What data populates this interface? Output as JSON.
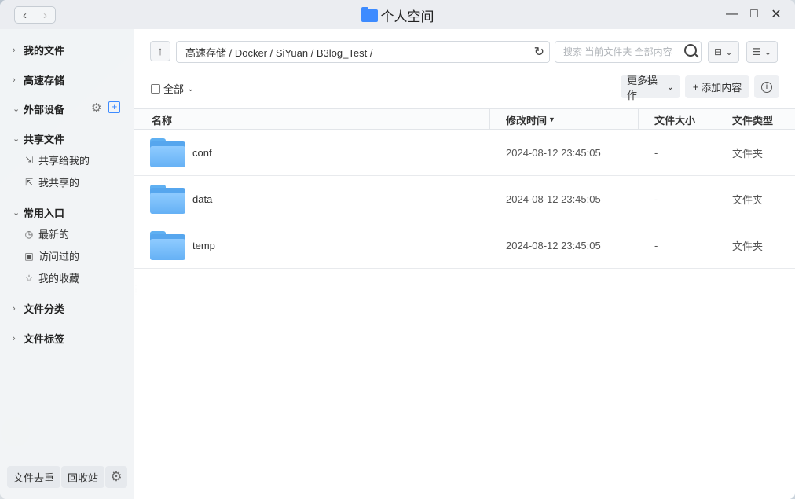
{
  "window": {
    "title": "个人空间",
    "nav_back": "‹",
    "nav_forward": "›",
    "controls": {
      "minimize": "—",
      "maximize": "□",
      "close": "✕"
    }
  },
  "sidebar": {
    "groups": [
      {
        "label": "我的文件",
        "expanded": false
      },
      {
        "label": "高速存储",
        "expanded": false
      },
      {
        "label": "外部设备",
        "expanded": true
      },
      {
        "label": "共享文件",
        "expanded": true
      },
      {
        "label": "常用入口",
        "expanded": true
      },
      {
        "label": "文件分类",
        "expanded": false
      },
      {
        "label": "文件标签",
        "expanded": false
      }
    ],
    "shared_items": [
      "共享给我的",
      "我共享的"
    ],
    "common_items": [
      "最新的",
      "访问过的",
      "我的收藏"
    ],
    "bottom": {
      "dedupe": "文件去重",
      "recycle": "回收站"
    }
  },
  "toolbar": {
    "path": "高速存储 / Docker / SiYuan / B3log_Test /",
    "search_placeholder": "搜索 当前文件夹 全部内容",
    "select_all": "全部",
    "more_actions": "更多操作",
    "add_content": "添加内容"
  },
  "table": {
    "headers": {
      "name": "名称",
      "modified": "修改时间",
      "size": "文件大小",
      "type": "文件类型"
    },
    "rows": [
      {
        "name": "conf",
        "modified": "2024-08-12 23:45:05",
        "size": "-",
        "type": "文件夹"
      },
      {
        "name": "data",
        "modified": "2024-08-12 23:45:05",
        "size": "-",
        "type": "文件夹"
      },
      {
        "name": "temp",
        "modified": "2024-08-12 23:45:05",
        "size": "-",
        "type": "文件夹"
      }
    ]
  },
  "colors": {
    "accent": "#3d8bff",
    "folder": "#65b1f5"
  }
}
